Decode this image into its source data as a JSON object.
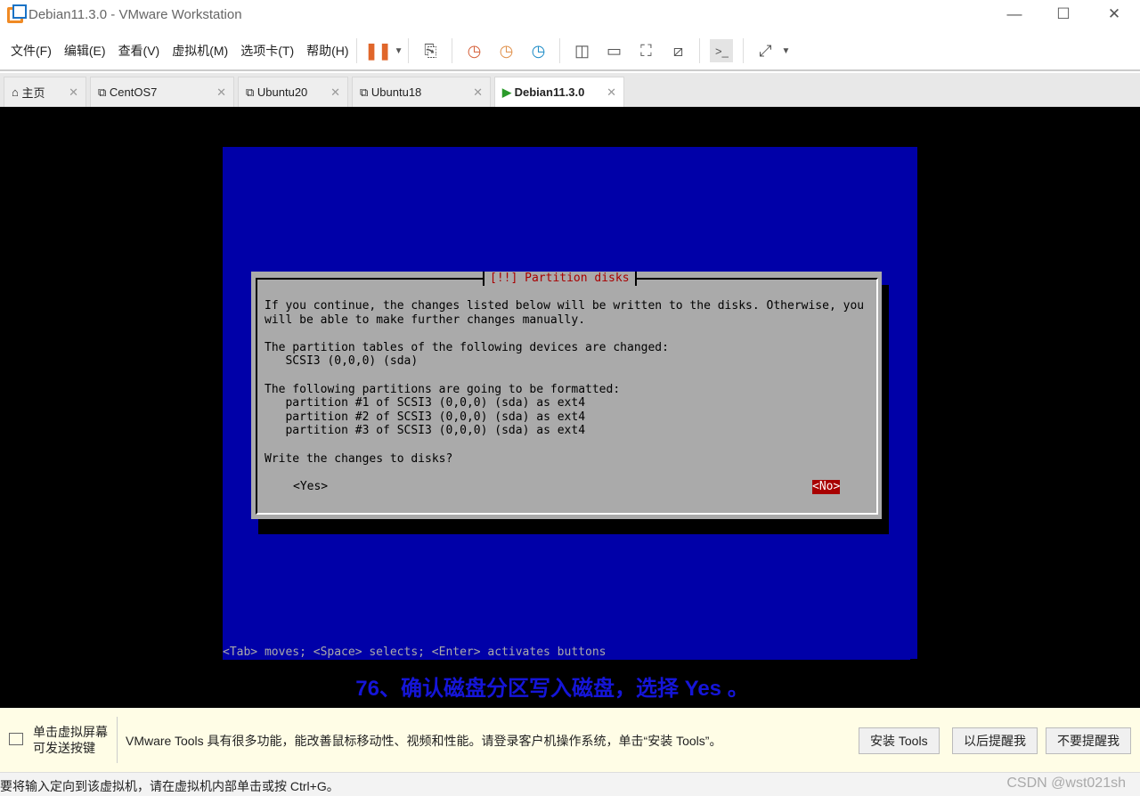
{
  "window": {
    "title": "Debian11.3.0 - VMware Workstation",
    "minimize": "—",
    "maximize": "☐",
    "close": "✕"
  },
  "menu": [
    "文件(F)",
    "编辑(E)",
    "查看(V)",
    "虚拟机(M)",
    "选项卡(T)",
    "帮助(H)"
  ],
  "tabs": [
    {
      "label": "主页"
    },
    {
      "label": "CentOS7"
    },
    {
      "label": "Ubuntu20"
    },
    {
      "label": "Ubuntu18"
    },
    {
      "label": "Debian11.3.0"
    }
  ],
  "installer": {
    "title": "[!!] Partition disks",
    "body": "If you continue, the changes listed below will be written to the disks. Otherwise, you\nwill be able to make further changes manually.\n\nThe partition tables of the following devices are changed:\n   SCSI3 (0,0,0) (sda)\n\nThe following partitions are going to be formatted:\n   partition #1 of SCSI3 (0,0,0) (sda) as ext4\n   partition #2 of SCSI3 (0,0,0) (sda) as ext4\n   partition #3 of SCSI3 (0,0,0) (sda) as ext4\n\nWrite the changes to disks?",
    "yes": "<Yes>",
    "no": "<No>",
    "help": "<Tab> moves; <Space> selects; <Enter> activates buttons"
  },
  "caption": "76、确认磁盘分区写入磁盘，选择 Yes 。",
  "notify": {
    "hint_line1": "单击虚拟屏幕",
    "hint_line2": "可发送按键",
    "message": "VMware Tools 具有很多功能，能改善鼠标移动性、视频和性能。请登录客户机操作系统，单击“安装 Tools”。",
    "install": "安装 Tools",
    "later": "以后提醒我",
    "never": "不要提醒我"
  },
  "status": {
    "text": "要将输入定向到该虚拟机，请在虚拟机内部单击或按 Ctrl+G。",
    "watermark": "CSDN @wst021sh"
  }
}
